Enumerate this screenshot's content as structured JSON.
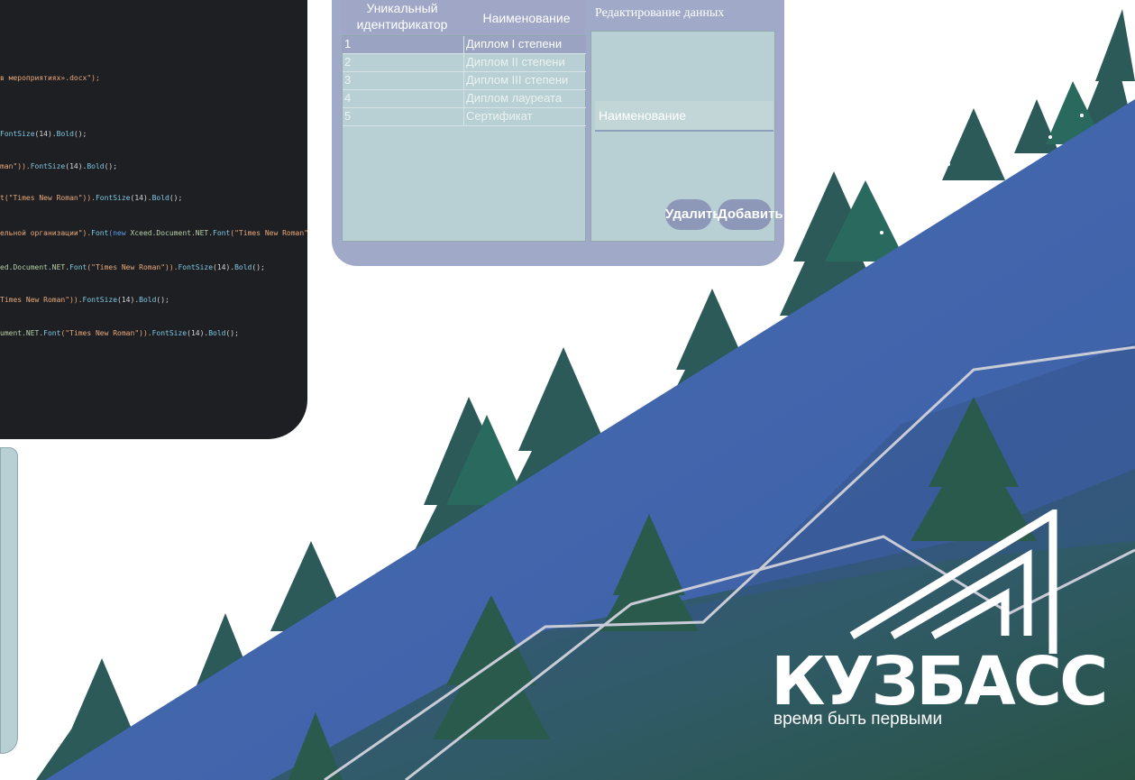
{
  "code": {
    "lines": [
      {
        "parts": [
          {
            "t": " в мероприятиях».docx\");",
            "c": "s"
          }
        ]
      },
      {
        "parts": [
          {
            "t": "FontSize",
            "c": "m"
          },
          {
            "t": "(14).",
            "c": ""
          },
          {
            "t": "Bold",
            "c": "m"
          },
          {
            "t": "();",
            "c": ""
          }
        ]
      },
      {
        "parts": [
          {
            "t": "man\")).",
            "c": "s"
          },
          {
            "t": "FontSize",
            "c": "m"
          },
          {
            "t": "(14).",
            "c": ""
          },
          {
            "t": "Bold",
            "c": "m"
          },
          {
            "t": "();",
            "c": ""
          }
        ]
      },
      {
        "parts": [
          {
            "t": "t(\"Times New Roman\")).",
            "c": "s"
          },
          {
            "t": "FontSize",
            "c": "m"
          },
          {
            "t": "(14).",
            "c": ""
          },
          {
            "t": "Bold",
            "c": "m"
          },
          {
            "t": "();",
            "c": ""
          }
        ]
      },
      {
        "parts": [
          {
            "t": "ельной организации\").",
            "c": "s"
          },
          {
            "t": "Font",
            "c": "m"
          },
          {
            "t": "(new ",
            "c": "k"
          },
          {
            "t": "Xceed.Document.NET.",
            "c": "n"
          },
          {
            "t": "Font",
            "c": "m"
          },
          {
            "t": "(\"Times New Roman\")).",
            "c": "s"
          }
        ]
      },
      {
        "parts": [
          {
            "t": "ed.Document.NET.",
            "c": "n"
          },
          {
            "t": "Font",
            "c": "m"
          },
          {
            "t": "(\"Times New Roman\")).",
            "c": "s"
          },
          {
            "t": "FontSize",
            "c": "m"
          },
          {
            "t": "(14).",
            "c": ""
          },
          {
            "t": "Bold",
            "c": "m"
          },
          {
            "t": "();",
            "c": ""
          }
        ]
      },
      {
        "parts": [
          {
            "t": "Times New Roman\")).",
            "c": "s"
          },
          {
            "t": "FontSize",
            "c": "m"
          },
          {
            "t": "(14).",
            "c": ""
          },
          {
            "t": "Bold",
            "c": "m"
          },
          {
            "t": "();",
            "c": ""
          }
        ]
      },
      {
        "parts": [
          {
            "t": "ument.NET.",
            "c": "n"
          },
          {
            "t": "Font",
            "c": "m"
          },
          {
            "t": "(\"Times New Roman\")).",
            "c": "s"
          },
          {
            "t": "FontSize",
            "c": "m"
          },
          {
            "t": "(14).",
            "c": ""
          },
          {
            "t": "Bold",
            "c": "m"
          },
          {
            "t": "();",
            "c": ""
          }
        ]
      }
    ]
  },
  "table": {
    "headers": {
      "id": "Уникальный идентификатор",
      "name": "Наименование"
    },
    "rows": [
      {
        "id": "1",
        "name": "Диплом I степени",
        "selected": true
      },
      {
        "id": "2",
        "name": "Диплом II степени",
        "selected": false
      },
      {
        "id": "3",
        "name": "Диплом III степени",
        "selected": false
      },
      {
        "id": "4",
        "name": "Диплом лауреата",
        "selected": false
      },
      {
        "id": "5",
        "name": "Сертификат",
        "selected": false
      }
    ]
  },
  "editor": {
    "title": "Редактирование данных",
    "name_placeholder": "Наименование",
    "name_value": "",
    "delete_label": "Удалить",
    "add_label": "Добавить"
  },
  "logo": {
    "name": "КУЗБАСС",
    "tagline": "время быть первыми"
  },
  "colors": {
    "slope_blue": "#3f64ad",
    "tree_dark_green": "#2a5645",
    "tree_teal": "#2f5a66",
    "window_lavender": "#a0aac8",
    "grid_bg": "#b8d0d3",
    "code_bg": "#1e1f22"
  }
}
